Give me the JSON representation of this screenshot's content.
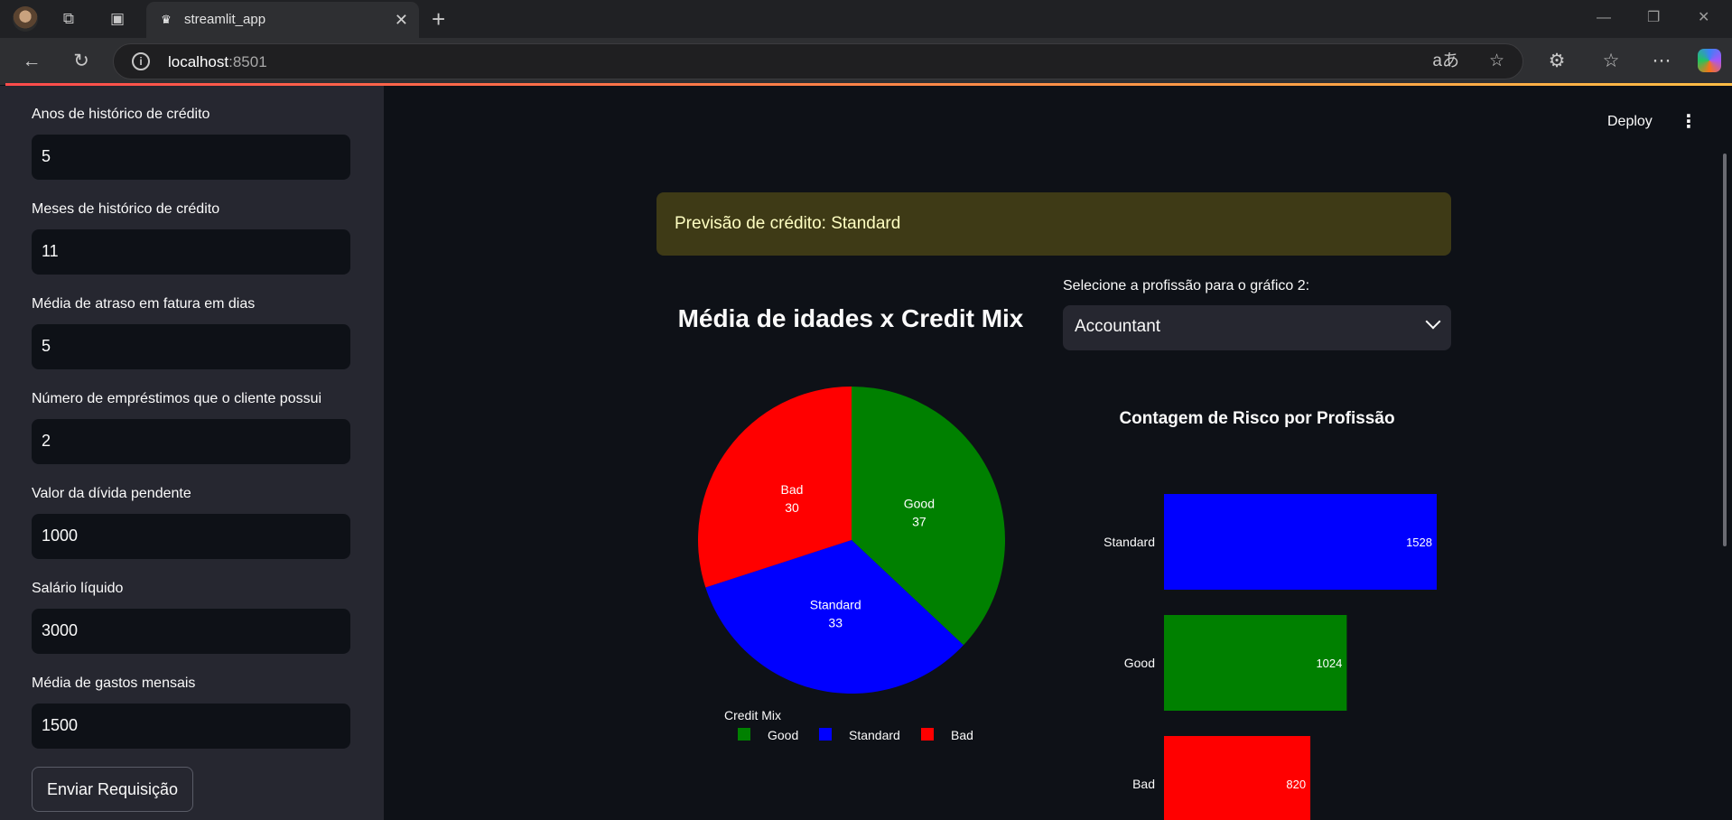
{
  "browser": {
    "tab_title": "streamlit_app",
    "url_host": "localhost",
    "url_port": ":8501"
  },
  "sidebar": {
    "fields": [
      {
        "label": "Anos de histórico de crédito",
        "value": "5"
      },
      {
        "label": "Meses de histórico de crédito",
        "value": "11"
      },
      {
        "label": "Média de atraso em fatura em dias",
        "value": "5"
      },
      {
        "label": "Número de empréstimos que o cliente possui",
        "value": "2"
      },
      {
        "label": "Valor da dívida pendente",
        "value": "1000"
      },
      {
        "label": "Salário líquido",
        "value": "3000"
      },
      {
        "label": "Média de gastos mensais",
        "value": "1500"
      }
    ],
    "submit_label": "Enviar Requisição"
  },
  "header": {
    "deploy_label": "Deploy"
  },
  "main": {
    "alert_text": "Previsão de crédito: Standard",
    "select_label": "Selecione a profissão para o gráfico 2:",
    "select_value": "Accountant"
  },
  "colors": {
    "good": "#008000",
    "standard": "#0000ff",
    "bad": "#ff0000",
    "alert_bg": "#3e3a16",
    "accent": "#ff4b4b"
  },
  "chart_data": [
    {
      "type": "pie",
      "title": "Média de idades x Credit Mix",
      "legend_title": "Credit Mix",
      "legend_placement": "bottom",
      "categories": [
        "Good",
        "Standard",
        "Bad"
      ],
      "values": [
        37,
        33,
        30
      ],
      "colors": [
        "#008000",
        "#0000ff",
        "#ff0000"
      ]
    },
    {
      "type": "bar",
      "orientation": "horizontal",
      "title": "Contagem de Risco por Profissão",
      "categories": [
        "Standard",
        "Good",
        "Bad"
      ],
      "values": [
        1528,
        1024,
        820
      ],
      "colors": [
        "#0000ff",
        "#008000",
        "#ff0000"
      ]
    }
  ]
}
